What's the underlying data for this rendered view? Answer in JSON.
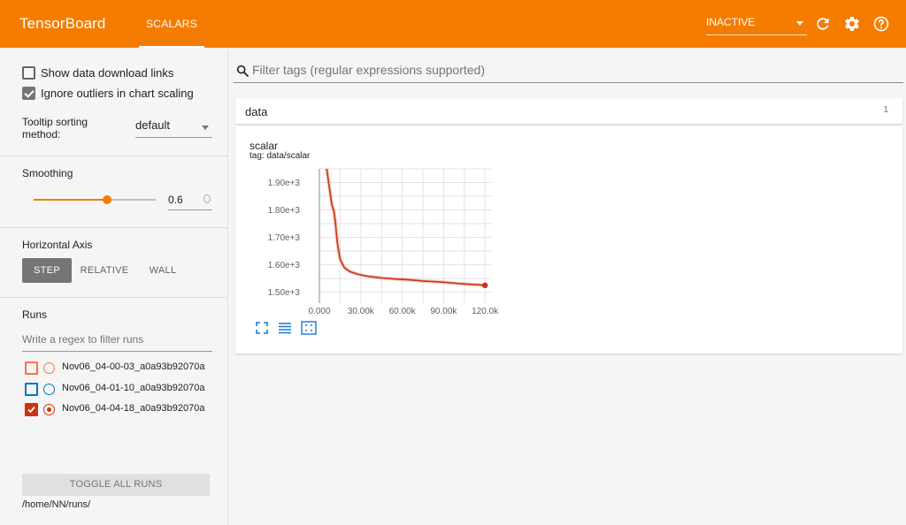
{
  "header": {
    "brand": "TensorBoard",
    "tab": "SCALARS",
    "status": "INACTIVE",
    "colors": {
      "bar": "#f57c00",
      "text": "#ffffff"
    },
    "icons": [
      "refresh-icon",
      "settings-icon",
      "help-icon"
    ]
  },
  "sidebar": {
    "show_download": {
      "label": "Show data download links",
      "checked": false
    },
    "ignore_outliers": {
      "label": "Ignore outliers in chart scaling",
      "checked": true
    },
    "tooltip_label": "Tooltip sorting method:",
    "tooltip_value": "default",
    "smoothing_title": "Smoothing",
    "smoothing_value": "0.6",
    "smoothing_fraction": 0.6,
    "horizontal_axis_title": "Horizontal Axis",
    "axis_buttons": [
      "STEP",
      "RELATIVE",
      "WALL"
    ],
    "axis_active": "STEP",
    "runs_title": "Runs",
    "runs_filter_placeholder": "Write a regex to filter runs",
    "runs": [
      {
        "name": "Nov06_04-00-03_a0a93b92070a",
        "color": "#ff7043",
        "checked": false
      },
      {
        "name": "Nov06_04-01-10_a0a93b92070a",
        "color": "#0077bb",
        "checked": false
      },
      {
        "name": "Nov06_04-04-18_a0a93b92070a",
        "color": "#cc3311",
        "checked": true
      }
    ],
    "toggle_all": "TOGGLE ALL RUNS",
    "logdir": "/home/NN/runs/"
  },
  "main": {
    "filter_placeholder": "Filter tags (regular expressions supported)",
    "group": {
      "title": "data",
      "count": "1"
    },
    "card": {
      "title": "scalar",
      "tag": "tag: data/scalar"
    }
  },
  "chart_data": {
    "type": "line",
    "title": "scalar",
    "xlim": [
      0,
      125000
    ],
    "ylim": [
      14600,
      19500
    ],
    "x_ticks": [
      0,
      30000,
      60000,
      90000,
      120000
    ],
    "x_tick_labels": [
      "0.000",
      "30.00k",
      "60.00k",
      "90.00k",
      "120.0k"
    ],
    "y_ticks": [
      15000,
      16000,
      17000,
      18000,
      19000
    ],
    "y_tick_labels": [
      "1.50e+3",
      "1.60e+3",
      "1.70e+3",
      "1.80e+3",
      "1.90e+3"
    ],
    "grid": true,
    "series": [
      {
        "color": "#cc3311",
        "x": [
          5000,
          7000,
          9000,
          10500,
          11500,
          13000,
          15000,
          18000,
          22000,
          28000,
          35000,
          45000,
          55000,
          65000,
          75000,
          85000,
          95000,
          105000,
          115000,
          120000
        ],
        "y": [
          19600,
          18900,
          18200,
          17950,
          17600,
          16800,
          16200,
          15900,
          15750,
          15650,
          15580,
          15520,
          15480,
          15450,
          15410,
          15380,
          15340,
          15300,
          15270,
          15250
        ]
      }
    ]
  }
}
